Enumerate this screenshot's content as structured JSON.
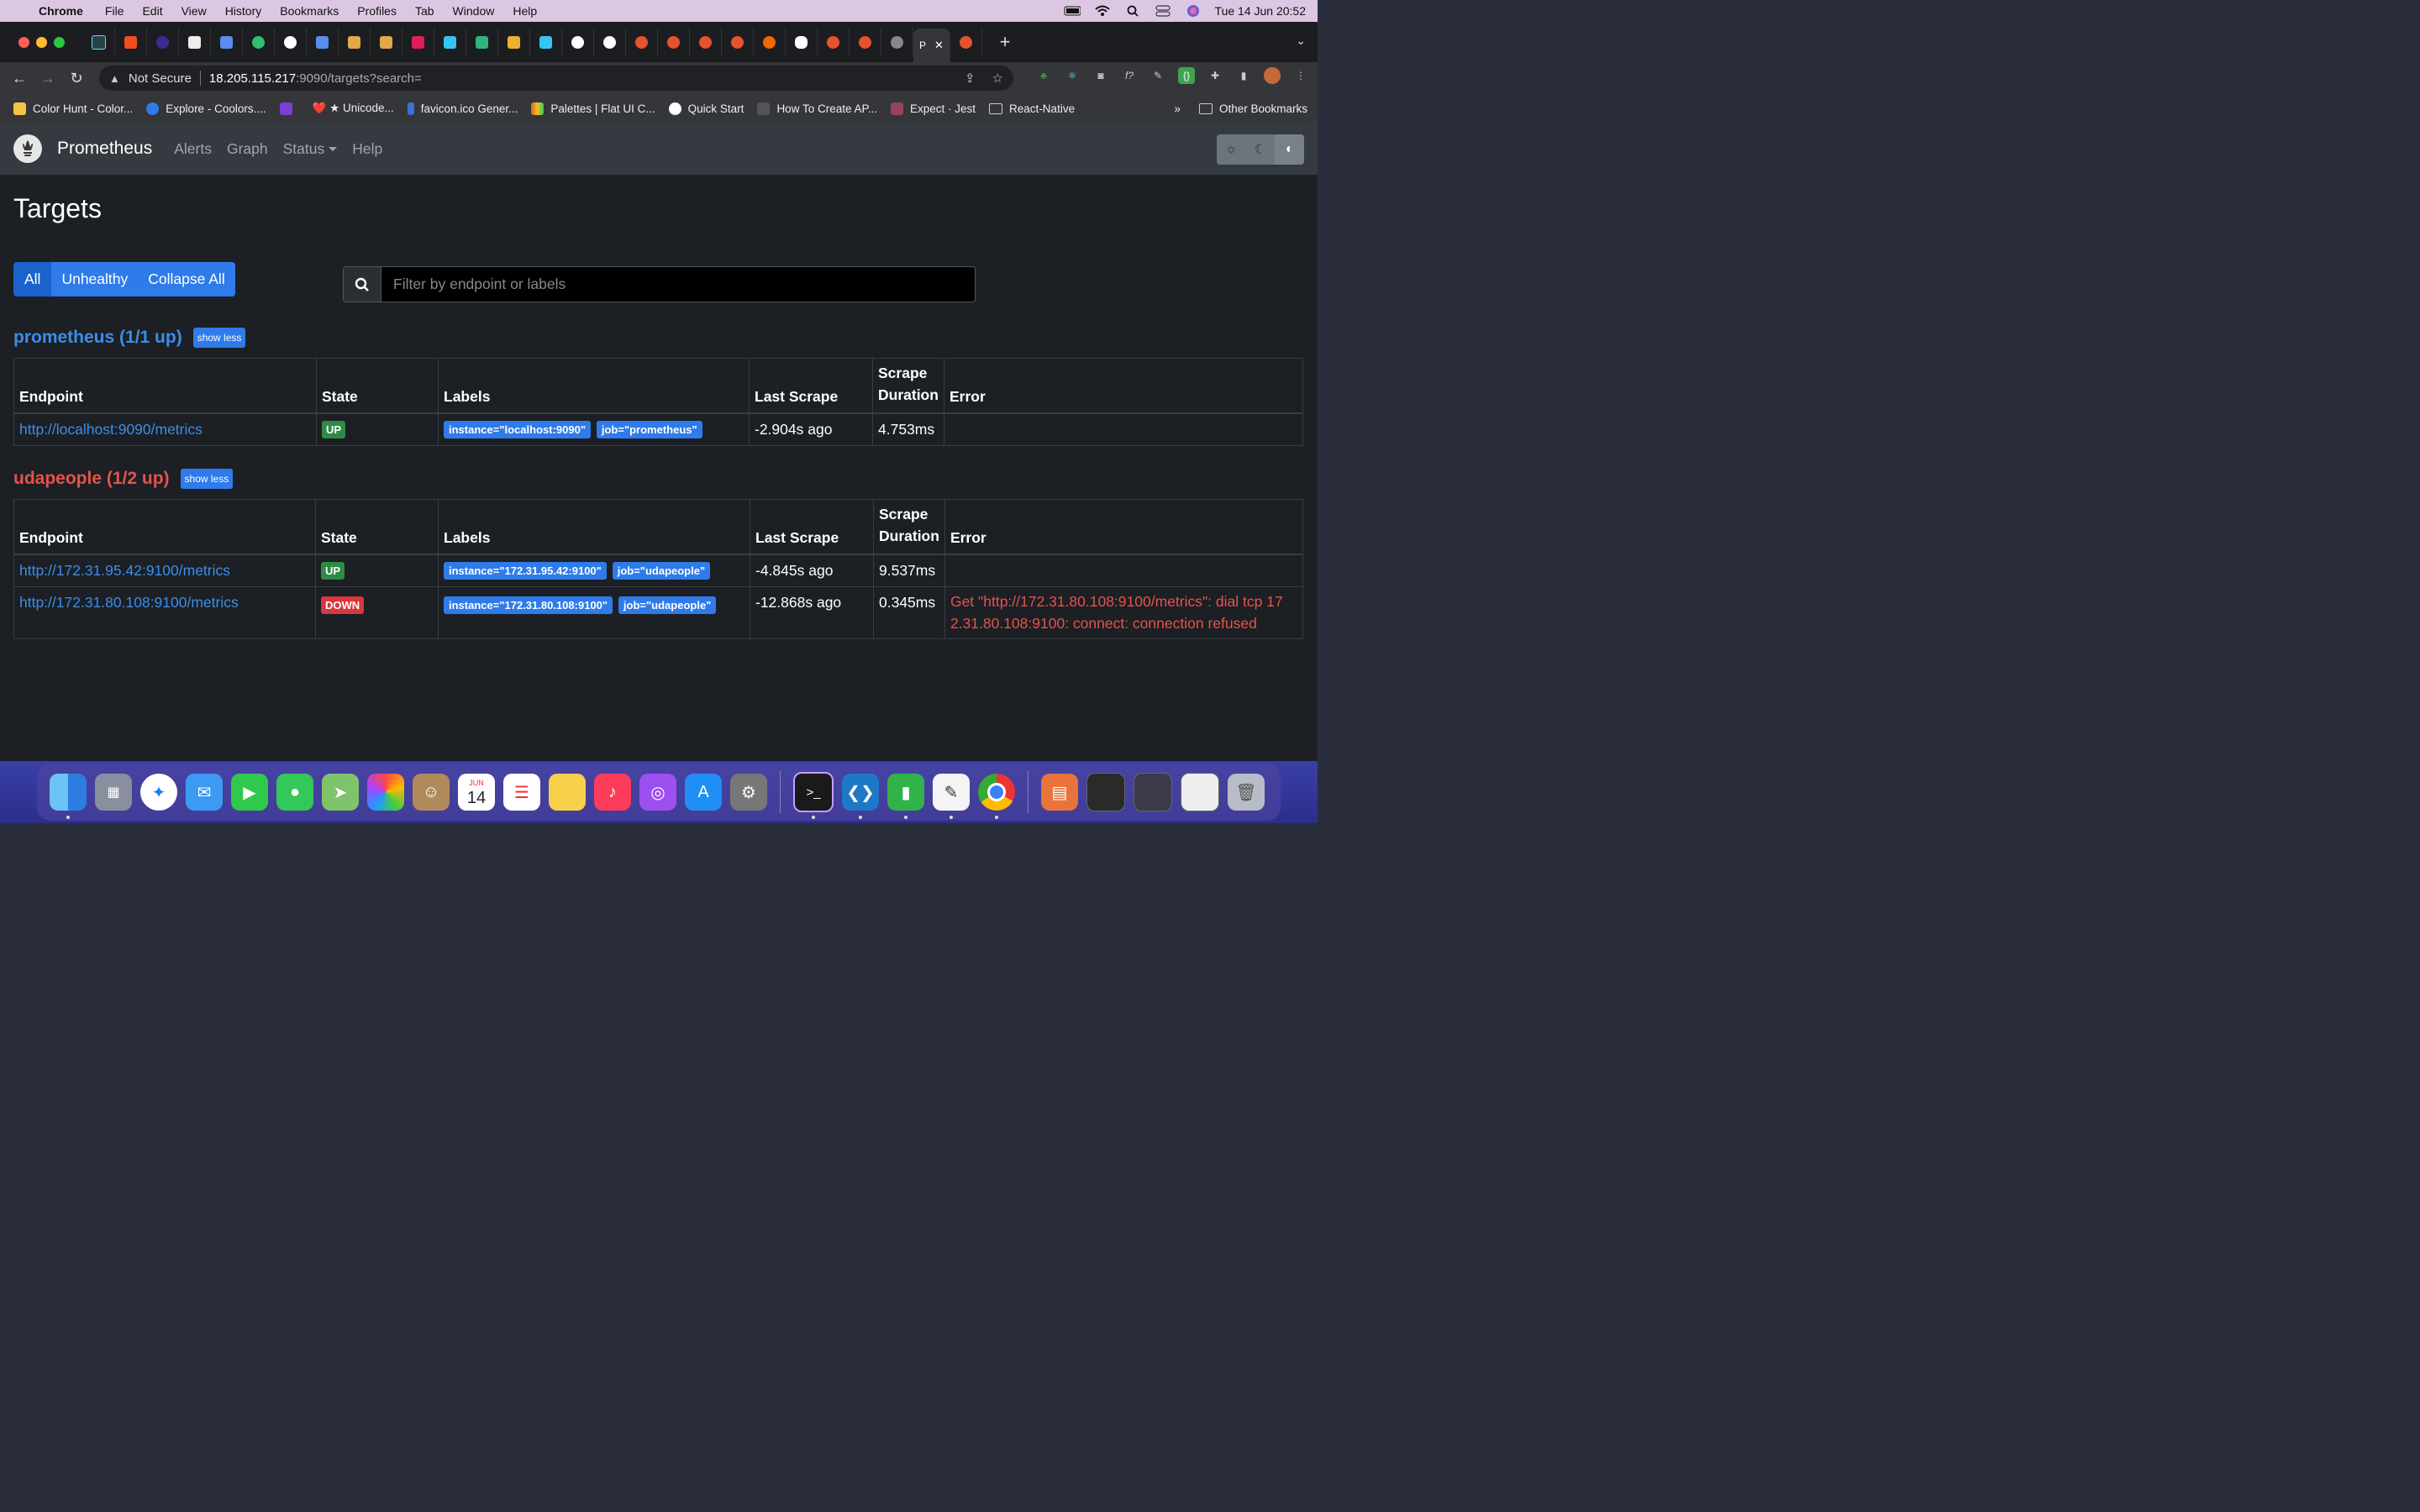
{
  "menubar": {
    "app": "Chrome",
    "items": [
      "File",
      "Edit",
      "View",
      "History",
      "Bookmarks",
      "Profiles",
      "Tab",
      "Window",
      "Help"
    ],
    "clock": "Tue 14 Jun  20:52"
  },
  "browser": {
    "active_tab_label": "P",
    "address": {
      "security": "Not Secure",
      "host": "18.205.115.217",
      "path": ":9090/targets?search="
    },
    "bookmarks": [
      {
        "label": "Color Hunt - Color...",
        "color": "#f5c542"
      },
      {
        "label": "Explore - Coolors....",
        "color": "#2f7bea"
      },
      {
        "label": "",
        "color": "#7a3fd6"
      },
      {
        "label": "❤️ ★ Unicode...",
        "color": ""
      },
      {
        "label": "favicon.ico Gener...",
        "color": "#3b6fd9"
      },
      {
        "label": "Palettes | Flat UI C...",
        "color": "#e25b3c"
      },
      {
        "label": "Quick Start",
        "color": "#ffffff"
      },
      {
        "label": "How To Create AP...",
        "color": "#333333"
      },
      {
        "label": "Expect · Jest",
        "color": "#99425b"
      },
      {
        "label": "React-Native",
        "color": "folder"
      }
    ],
    "other_bookmarks": "Other Bookmarks",
    "overflow": "»"
  },
  "app": {
    "brand": "Prometheus",
    "nav": [
      "Alerts",
      "Graph",
      "Status",
      "Help"
    ],
    "page_title": "Targets",
    "filters": [
      "All",
      "Unhealthy",
      "Collapse All"
    ],
    "search_placeholder": "Filter by endpoint or labels",
    "columns": [
      "Endpoint",
      "State",
      "Labels",
      "Last Scrape",
      "Scrape Duration",
      "Error"
    ],
    "pools": [
      {
        "title": "prometheus (1/1 up)",
        "toggle": "show less",
        "rows": [
          {
            "endpoint": "http://localhost:9090/metrics",
            "state": "UP",
            "labels": [
              "instance=\"localhost:9090\"",
              "job=\"prometheus\""
            ],
            "last_scrape": "-2.904s ago",
            "duration": "4.753ms",
            "error": ""
          }
        ]
      },
      {
        "title": "udapeople (1/2 up)",
        "toggle": "show less",
        "rows": [
          {
            "endpoint": "http://172.31.95.42:9100/metrics",
            "state": "UP",
            "labels": [
              "instance=\"172.31.95.42:9100\"",
              "job=\"udapeople\""
            ],
            "last_scrape": "-4.845s ago",
            "duration": "9.537ms",
            "error": ""
          },
          {
            "endpoint": "http://172.31.80.108:9100/metrics",
            "state": "DOWN",
            "labels": [
              "instance=\"172.31.80.108:9100\"",
              "job=\"udapeople\""
            ],
            "last_scrape": "-12.868s ago",
            "duration": "0.345ms",
            "error_line1": "Get \"http://172.31.80.108:9100/metrics\": dial tcp 17",
            "error_line2": "2.31.80.108:9100: connect: connection refused"
          }
        ]
      }
    ]
  },
  "dock": {
    "calendar_month": "JUN",
    "calendar_day": "14"
  }
}
